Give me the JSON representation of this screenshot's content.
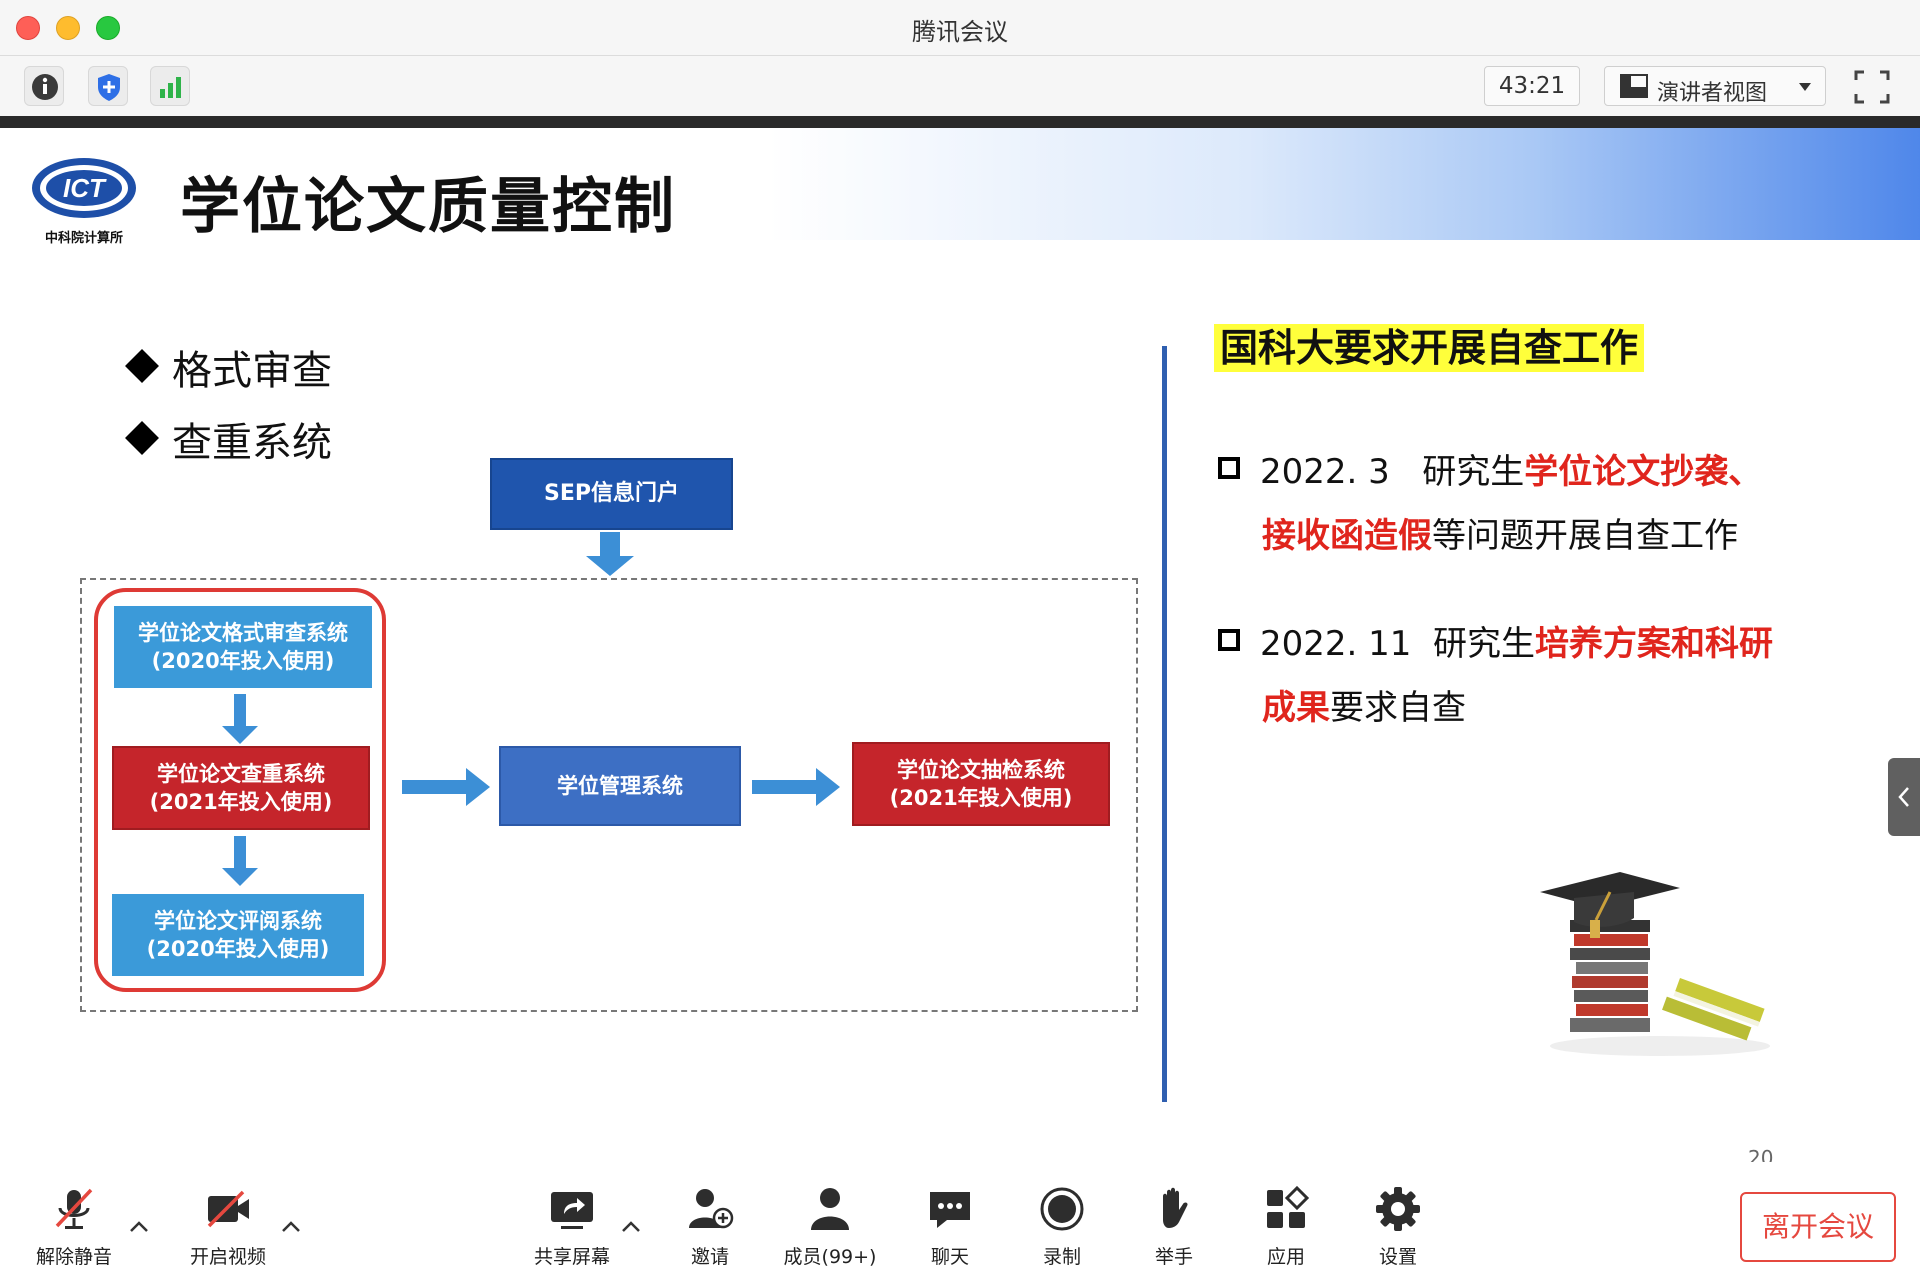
{
  "window": {
    "title": "腾讯会议"
  },
  "toolbar": {
    "timer": "43:21",
    "view_mode": "演讲者视图"
  },
  "slide": {
    "title": "学位论文质量控制",
    "logo_text": "ICT",
    "logo_sub": "中科院计算所",
    "bullets": [
      "格式审查",
      "查重系统"
    ],
    "flow": {
      "portal": "SEP信息门户",
      "format_check": [
        "学位论文格式审查系统",
        "(2020年投入使用)"
      ],
      "plagiarism": [
        "学位论文查重系统",
        "(2021年投入使用)"
      ],
      "review": [
        "学位论文评阅系统",
        "(2020年投入使用)"
      ],
      "degree_mgmt": "学位管理系统",
      "spot_check": [
        "学位论文抽检系统",
        "(2021年投入使用)"
      ]
    },
    "right_heading": "国科大要求开展自查工作",
    "items": [
      {
        "date": "2022. 3",
        "prefix": "研究生",
        "red1": "学位论文抄袭、",
        "red2": "接收函造假",
        "suffix": "等问题开展自查工作"
      },
      {
        "date": "2022. 11",
        "prefix": "研究生",
        "red1": "培养方案和科研",
        "red2": "成果",
        "suffix": "要求自查"
      }
    ],
    "page_number": "20"
  },
  "controls": {
    "unmute": "解除静音",
    "start_video": "开启视频",
    "share_screen": "共享屏幕",
    "invite": "邀请",
    "members": "成员(99+)",
    "chat": "聊天",
    "record": "录制",
    "raise_hand": "举手",
    "apps": "应用",
    "settings": "设置",
    "leave": "离开会议"
  },
  "colors": {
    "accent_red": "#e0251d",
    "flow_blue": "#3b9ad9",
    "flow_red": "#c5252b",
    "portal_navy": "#1f55ad",
    "leave_red": "#e5483f"
  }
}
